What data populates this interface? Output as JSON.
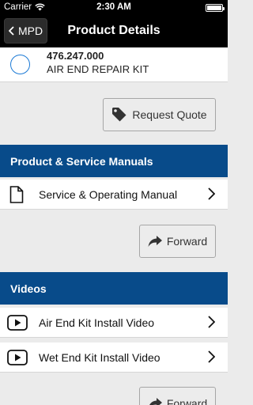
{
  "status_bar": {
    "carrier": "Carrier",
    "time": "2:30 AM"
  },
  "nav": {
    "back_label": "MPD",
    "title": "Product Details"
  },
  "product": {
    "number": "476.247.000",
    "name": "AIR END REPAIR KIT",
    "selected": false
  },
  "request_quote": {
    "label": "Request Quote",
    "icon": "tag-icon"
  },
  "manuals": {
    "header": "Product & Service Manuals",
    "items": [
      {
        "label": "Service & Operating Manual",
        "icon": "document-icon"
      }
    ],
    "forward_label": "Forward"
  },
  "videos": {
    "header": "Videos",
    "items": [
      {
        "label": "Air End Kit Install Video",
        "icon": "video-play-icon"
      },
      {
        "label": "Wet End Kit Install Video",
        "icon": "video-play-icon"
      }
    ],
    "forward_label": "Forward"
  },
  "colors": {
    "header_blue": "#084b8a",
    "radio_blue": "#1c7ad5",
    "background": "#ebebeb"
  }
}
